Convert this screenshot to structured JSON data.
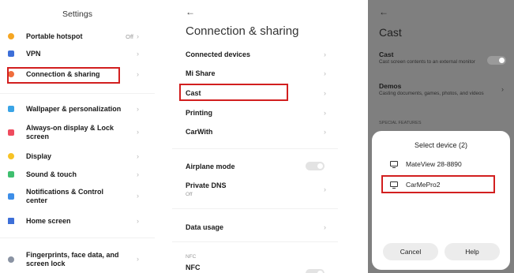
{
  "settings": {
    "title": "Settings",
    "items": [
      {
        "label": "Portable hotspot",
        "value": "Off"
      },
      {
        "label": "VPN"
      },
      {
        "label": "Connection & sharing"
      },
      {
        "label": "Wallpaper & personalization"
      },
      {
        "label": "Always-on display & Lock screen"
      },
      {
        "label": "Display"
      },
      {
        "label": "Sound & touch"
      },
      {
        "label": "Notifications & Control center"
      },
      {
        "label": "Home screen"
      },
      {
        "label": "Fingerprints, face data, and screen lock"
      }
    ],
    "colors": {
      "highlight_border": "#d21f1f"
    }
  },
  "connection": {
    "back": "←",
    "title": "Connection & sharing",
    "items": [
      {
        "label": "Connected devices"
      },
      {
        "label": "Mi Share"
      },
      {
        "label": "Cast"
      },
      {
        "label": "Printing"
      },
      {
        "label": "CarWith"
      },
      {
        "label": "Airplane mode"
      },
      {
        "label": "Private DNS",
        "sub": "Off"
      },
      {
        "label": "Data usage"
      }
    ],
    "section_nfc": "NFC",
    "nfc_item": "NFC"
  },
  "cast": {
    "back": "←",
    "title": "Cast",
    "cast_label": "Cast",
    "cast_desc": "Cast screen contents to an external monitor",
    "demos_label": "Demos",
    "demos_desc": "Casting documents, games, photos, and videos",
    "section_special": "SPECIAL FEATURES",
    "dialog": {
      "title": "Select device (2)",
      "devices": [
        "MateView 28-8890",
        "CarMePro2"
      ],
      "cancel": "Cancel",
      "help": "Help"
    }
  }
}
